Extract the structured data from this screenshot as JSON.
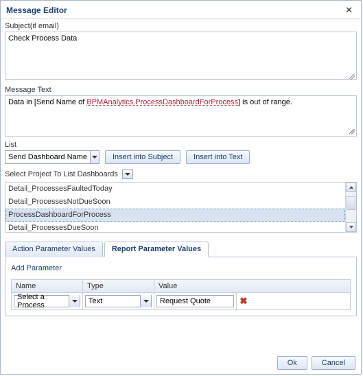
{
  "dialog": {
    "title": "Message Editor"
  },
  "subject": {
    "label": "Subject(if email)",
    "value": "Check Process Data"
  },
  "message": {
    "label": "Message Text",
    "prefix": "Data in [Send Name of ",
    "link": "BPMAnalytics.ProcessDashboardForProcess",
    "suffix": "] is out of range."
  },
  "list": {
    "label": "List",
    "selected": "Send Dashboard Name",
    "insert_subject": "Insert into Subject",
    "insert_text": "Insert into Text"
  },
  "projects": {
    "label": "Select Project To List Dashboards",
    "items": [
      "Detail_ProcessesFaultedToday",
      "Detail_ProcessesNotDueSoon",
      "ProcessDashboardForProcess",
      "Detail_ProcessesDueSoon"
    ],
    "selected_index": 2
  },
  "tabs": {
    "action": "Action Parameter Values",
    "report": "Report Parameter Values"
  },
  "params": {
    "add_label": "Add Parameter",
    "headers": {
      "name": "Name",
      "type": "Type",
      "value": "Value"
    },
    "row": {
      "name": "Select a Process",
      "type": "Text",
      "value": "Request Quote"
    }
  },
  "footer": {
    "ok": "Ok",
    "cancel": "Cancel"
  }
}
